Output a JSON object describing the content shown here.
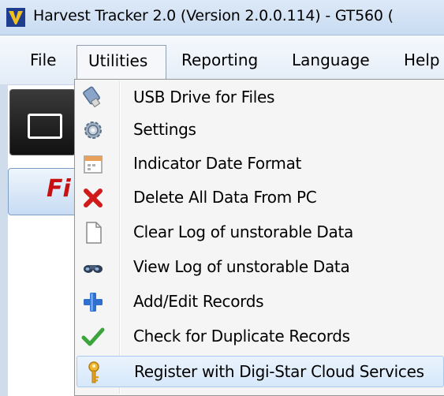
{
  "window": {
    "title": "Harvest Tracker 2.0 (Version 2.0.0.114) - GT560 ("
  },
  "menubar": {
    "items": [
      "File",
      "Utilities",
      "Reporting",
      "Language",
      "Help"
    ]
  },
  "background": {
    "button_text": "Fi"
  },
  "utilities_menu": {
    "items": [
      {
        "label": "USB Drive for Files",
        "icon": "usb-drive-icon"
      },
      {
        "label": "Settings",
        "icon": "gear-icon"
      },
      {
        "label": "Indicator Date Format",
        "icon": "calendar-icon"
      },
      {
        "label": "Delete All Data From PC",
        "icon": "red-x-icon"
      },
      {
        "label": "Clear Log of unstorable Data",
        "icon": "blank-page-icon"
      },
      {
        "label": "View Log of unstorable Data",
        "icon": "binoculars-icon"
      },
      {
        "label": "Add/Edit Records",
        "icon": "blue-plus-icon"
      },
      {
        "label": "Check for Duplicate Records",
        "icon": "green-check-icon"
      },
      {
        "label": "Register with Digi-Star Cloud Services",
        "icon": "key-icon",
        "highlighted": true
      }
    ]
  },
  "colors": {
    "highlight": "#d6e8fb",
    "red_x": "#d11a1a",
    "plus_blue": "#2f6fd0",
    "check_green": "#3ba53b",
    "key_gold": "#e0a020"
  }
}
